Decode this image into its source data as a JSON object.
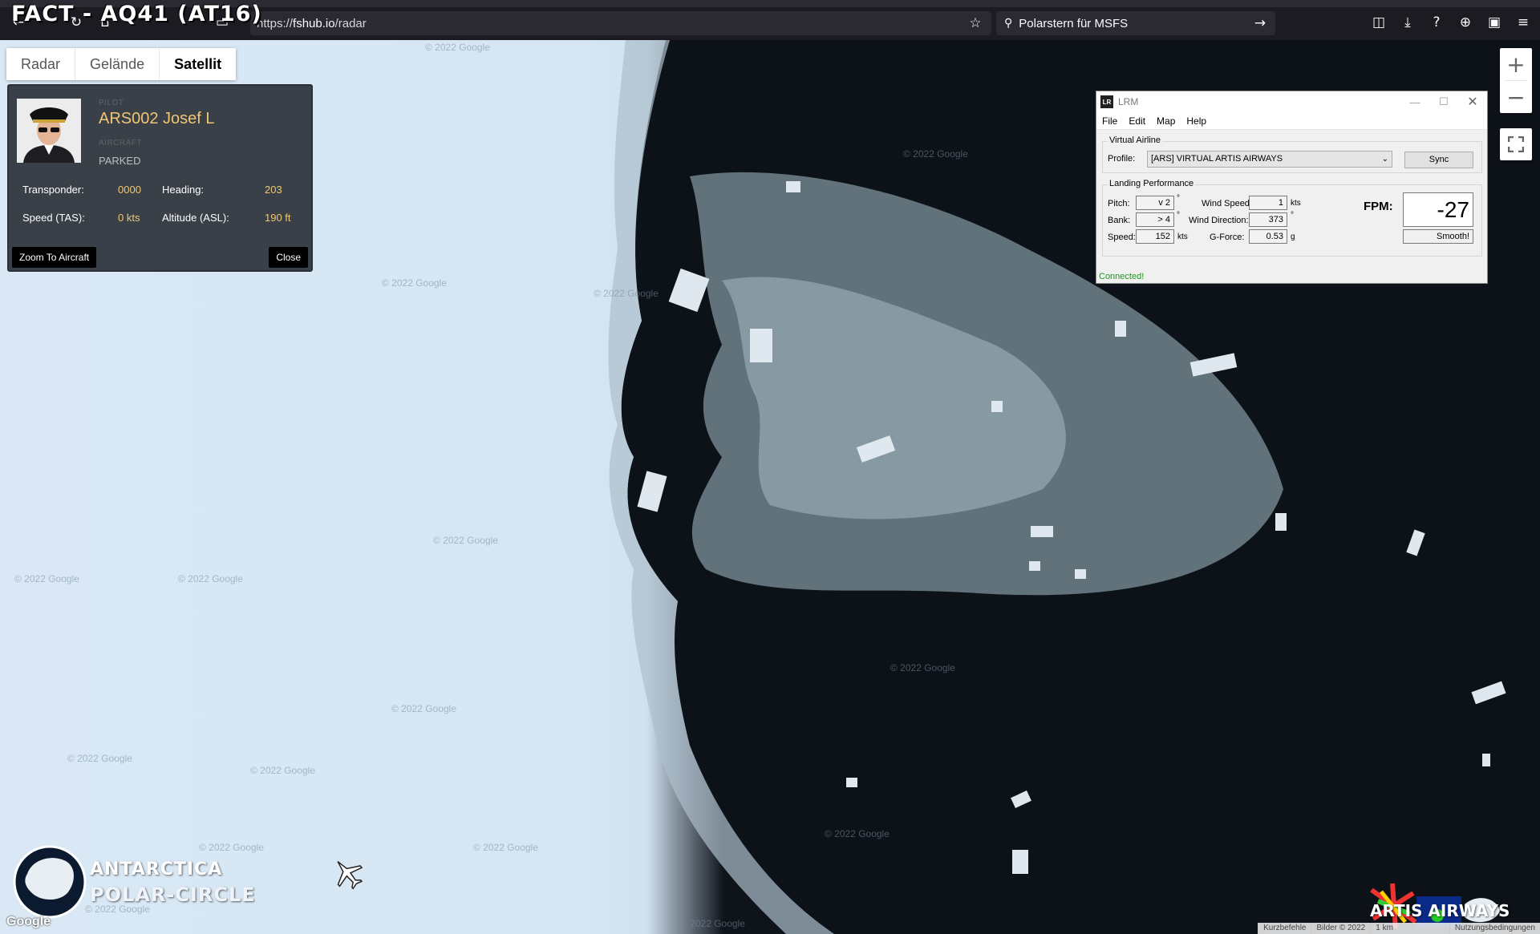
{
  "overlay_title": "FACT - AQ41 (AT16)",
  "browser": {
    "url_prefix": "https://",
    "url_host": "fshub.io",
    "url_path": "/radar",
    "search_text": "Polarstern für MSFS"
  },
  "map": {
    "types": [
      "Radar",
      "Gelände",
      "Satellit"
    ],
    "active_type": "Satellit",
    "credit": "© 2022 Google"
  },
  "pilot": {
    "pilot_label": "PILOT",
    "name": "ARS002 Josef L",
    "aircraft_label": "AIRCRAFT",
    "status": "PARKED",
    "transponder_label": "Transponder:",
    "transponder": "0000",
    "heading_label": "Heading:",
    "heading": "203",
    "speed_label": "Speed (TAS):",
    "speed": "0 kts",
    "altitude_label": "Altitude (ASL):",
    "altitude": "190 ft",
    "zoom_button": "Zoom To Aircraft",
    "close_button": "Close"
  },
  "lrm": {
    "title": "LRM",
    "logo": "LR",
    "menu": [
      "File",
      "Edit",
      "Map",
      "Help"
    ],
    "virtual_airline_label": "Virtual Airline",
    "profile_label": "Profile:",
    "profile_value": "[ARS] VIRTUAL ARTIS AIRWAYS",
    "sync_button": "Sync",
    "landing_label": "Landing Performance",
    "pitch_label": "Pitch:",
    "pitch_value": "v  2",
    "bank_label": "Bank:",
    "bank_value": ">  4",
    "speed_label": "Speed:",
    "speed_value": "152",
    "speed_unit": "kts",
    "wind_speed_label": "Wind Speed:",
    "wind_speed_value": "1",
    "wind_speed_unit": "kts",
    "wind_dir_label": "Wind Direction:",
    "wind_dir_value": "373",
    "gforce_label": "G-Force:",
    "gforce_value": "0.53",
    "gforce_unit": "g",
    "degree_unit": "°",
    "fpm_label": "FPM:",
    "fpm_value": "-27",
    "rating": "Smooth!",
    "status": "Connected!"
  },
  "branding": {
    "line1": "ANTARCTICA",
    "line2": "POLAR-CIRCLE",
    "airline": "ARTIS AIRWAYS",
    "google": "Google"
  },
  "footer": [
    "Kurzbefehle",
    "Bilder © 2022",
    "1 km",
    "Nutzungsbedingungen"
  ]
}
